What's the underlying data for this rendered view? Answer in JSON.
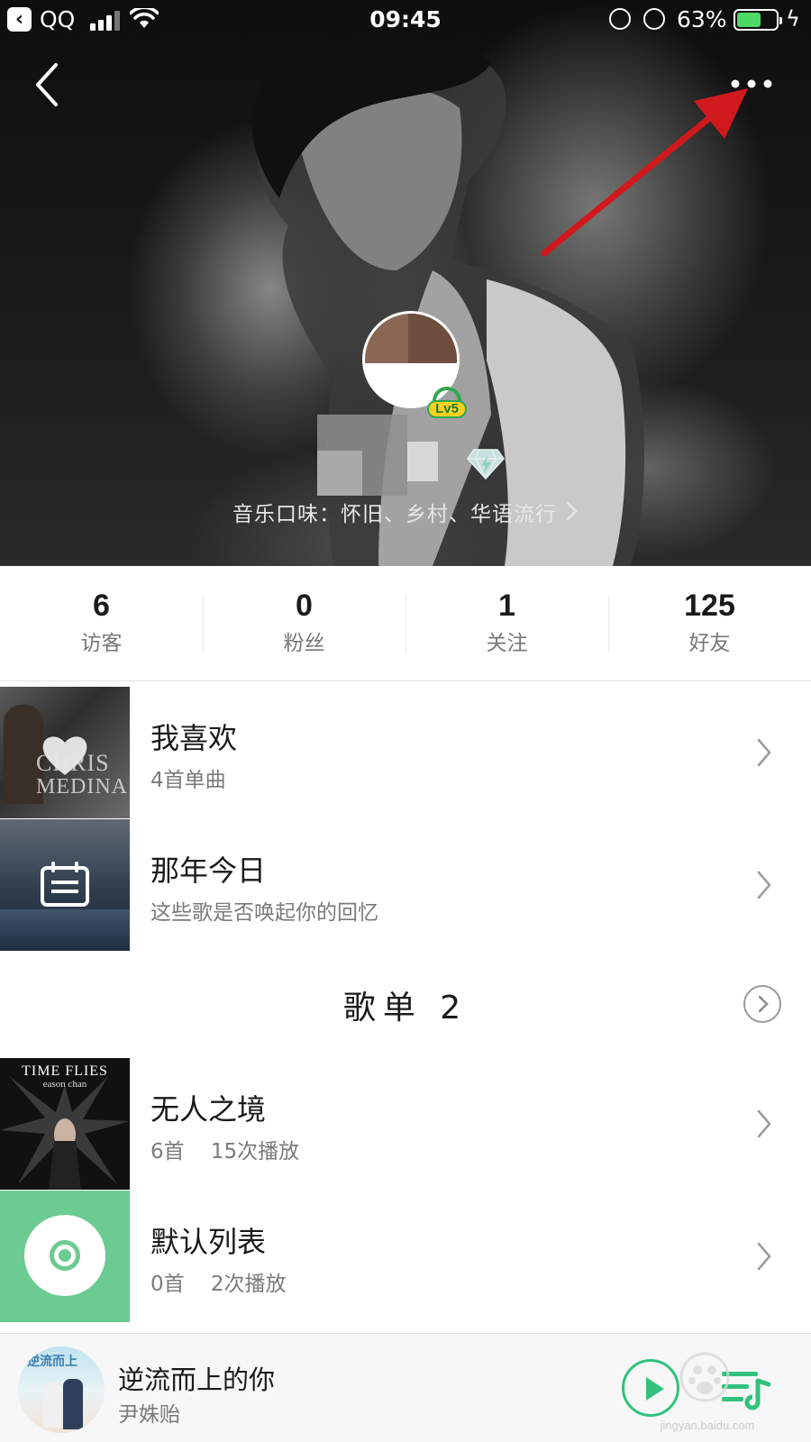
{
  "status_bar": {
    "back_app": "QQ",
    "time": "09:45",
    "battery_percent": "63%",
    "battery_level": 0.63
  },
  "nav": {
    "back_icon": "chevron-left-icon",
    "more_icon": "more-dots-icon"
  },
  "profile": {
    "level": "Lv5",
    "taste": "音乐口味：怀旧、乡村、华语流行"
  },
  "stats": [
    {
      "value": "6",
      "label": "访客"
    },
    {
      "value": "0",
      "label": "粉丝"
    },
    {
      "value": "1",
      "label": "关注"
    },
    {
      "value": "125",
      "label": "好友"
    }
  ],
  "collections": [
    {
      "title": "我喜欢",
      "subtitle": "4首单曲",
      "cover_text_1": "CHRIS",
      "cover_text_2": "MEDINA"
    },
    {
      "title": "那年今日",
      "subtitle": "这些歌是否唤起你的回忆"
    }
  ],
  "playlist_section": {
    "title": "歌单  2"
  },
  "playlists": [
    {
      "title": "无人之境",
      "subtitle": "6首    15次播放",
      "cover_text_1": "TIME FLIES",
      "cover_text_2": "eason chan"
    },
    {
      "title": "默认列表",
      "subtitle": "0首    2次播放"
    }
  ],
  "player": {
    "song": "逆流而上的你",
    "artist": "尹姝贻",
    "cover_text": "逆流而上"
  },
  "watermark": {
    "text": "jingyan.baidu.com"
  },
  "colors": {
    "accent_green": "#31c27c",
    "annotation_red": "#d0191c"
  }
}
